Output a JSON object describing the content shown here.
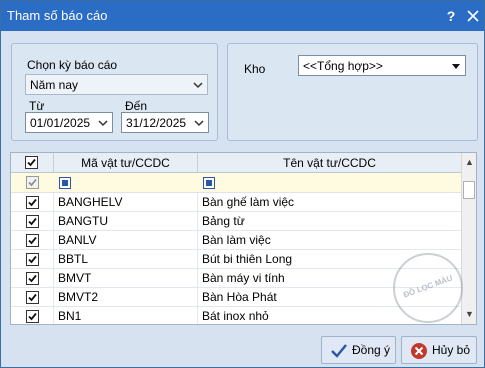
{
  "window": {
    "title": "Tham số báo cáo",
    "help_glyph": "?",
    "close_glyph": "✕"
  },
  "report_period": {
    "label": "Chọn kỳ báo cáo",
    "selected": "Năm nay",
    "from_label": "Từ",
    "from_value": "01/01/2025",
    "to_label": "Đến",
    "to_value": "31/12/2025"
  },
  "warehouse": {
    "label": "Kho",
    "selected": "<<Tổng hợp>>"
  },
  "grid": {
    "columns": [
      "Mã vật tư/CCDC",
      "Tên vật tư/CCDC"
    ],
    "rows": [
      {
        "code": "BANGHELV",
        "name": "Bàn ghế làm việc",
        "checked": true
      },
      {
        "code": "BANGTU",
        "name": "Bảng từ",
        "checked": true
      },
      {
        "code": "BANLV",
        "name": "Bàn làm việc",
        "checked": true
      },
      {
        "code": "BBTL",
        "name": "Bút bi thiên Long",
        "checked": true
      },
      {
        "code": "BMVT",
        "name": "Bàn máy vi tính",
        "checked": true
      },
      {
        "code": "BMVT2",
        "name": "Bàn Hòa Phát",
        "checked": true
      },
      {
        "code": "BN1",
        "name": "Bát inox nhỏ",
        "checked": true
      }
    ]
  },
  "watermark": {
    "text": "ĐỒ LỌC MÀU"
  },
  "buttons": {
    "ok": "Đồng ý",
    "cancel": "Hủy bỏ"
  },
  "colors": {
    "titlebar": "#2b6cc4",
    "accent": "#2a55a8",
    "cancel_icon": "#c0392b"
  }
}
